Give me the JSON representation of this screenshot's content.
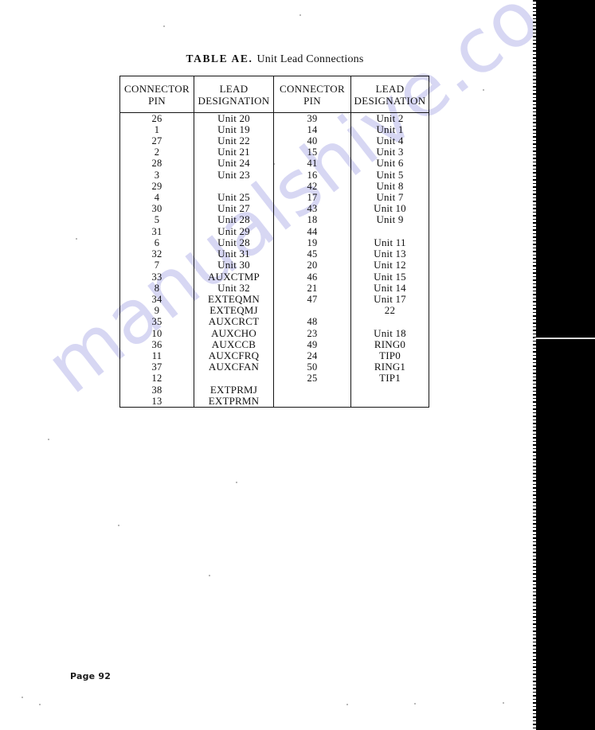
{
  "document": {
    "page_number_label": "Page 92",
    "watermark_text": "manualshive.com"
  },
  "caption": {
    "label": "TABLE AE.",
    "title": "Unit Lead Connections"
  },
  "table": {
    "headers": [
      {
        "line1": "CONNECTOR",
        "line2": "PIN"
      },
      {
        "line1": "LEAD",
        "line2": "DESIGNATION"
      },
      {
        "line1": "CONNECTOR",
        "line2": "PIN"
      },
      {
        "line1": "LEAD",
        "line2": "DESIGNATION"
      }
    ],
    "rows": [
      {
        "pin_a": "26",
        "lead_a": "Unit 20",
        "pin_b": "39",
        "lead_b": "Unit 2"
      },
      {
        "pin_a": "1",
        "lead_a": "Unit 19",
        "pin_b": "14",
        "lead_b": "Unit 1"
      },
      {
        "pin_a": "27",
        "lead_a": "Unit 22",
        "pin_b": "40",
        "lead_b": "Unit 4"
      },
      {
        "pin_a": "2",
        "lead_a": "Unit 21",
        "pin_b": "15",
        "lead_b": "Unit 3"
      },
      {
        "pin_a": "28",
        "lead_a": "Unit 24",
        "pin_b": "41",
        "lead_b": "Unit 6"
      },
      {
        "pin_a": "3",
        "lead_a": "Unit 23",
        "pin_b": "16",
        "lead_b": "Unit 5"
      },
      {
        "pin_a": "29",
        "lead_a": "",
        "pin_b": "42",
        "lead_b": "Unit 8"
      },
      {
        "pin_a": "4",
        "lead_a": "Unit 25",
        "pin_b": "17",
        "lead_b": "Unit 7"
      },
      {
        "pin_a": "30",
        "lead_a": "Unit 27",
        "pin_b": "43",
        "lead_b": "Unit 10"
      },
      {
        "pin_a": "5",
        "lead_a": "Unit 28",
        "pin_b": "18",
        "lead_b": "Unit 9"
      },
      {
        "pin_a": "31",
        "lead_a": "Unit 29",
        "pin_b": "44",
        "lead_b": ""
      },
      {
        "pin_a": "6",
        "lead_a": "Unit 28",
        "pin_b": "19",
        "lead_b": "Unit 11"
      },
      {
        "pin_a": "32",
        "lead_a": "Unit 31",
        "pin_b": "45",
        "lead_b": "Unit 13"
      },
      {
        "pin_a": "7",
        "lead_a": "Unit 30",
        "pin_b": "20",
        "lead_b": "Unit 12"
      },
      {
        "pin_a": "33",
        "lead_a": "AUXCTMP",
        "pin_b": "46",
        "lead_b": "Unit 15"
      },
      {
        "pin_a": "8",
        "lead_a": "Unit 32",
        "pin_b": "21",
        "lead_b": "Unit 14"
      },
      {
        "pin_a": "34",
        "lead_a": "EXTEQMN",
        "pin_b": "47",
        "lead_b": "Unit 17"
      },
      {
        "pin_a": "9",
        "lead_a": "EXTEQMJ",
        "pin_b": "",
        "lead_b": "22"
      },
      {
        "pin_a": "35",
        "lead_a": "AUXCRCT",
        "pin_b": "48",
        "lead_b": ""
      },
      {
        "pin_a": "10",
        "lead_a": "AUXCHO",
        "pin_b": "23",
        "lead_b": "Unit 18"
      },
      {
        "pin_a": "36",
        "lead_a": "AUXCCB",
        "pin_b": "49",
        "lead_b": "RING0"
      },
      {
        "pin_a": "11",
        "lead_a": "AUXCFRQ",
        "pin_b": "24",
        "lead_b": "TIP0"
      },
      {
        "pin_a": "37",
        "lead_a": "AUXCFAN",
        "pin_b": "50",
        "lead_b": "RING1"
      },
      {
        "pin_a": "12",
        "lead_a": "",
        "pin_b": "25",
        "lead_b": "TIP1"
      },
      {
        "pin_a": "38",
        "lead_a": "EXTPRMJ",
        "pin_b": "",
        "lead_b": ""
      },
      {
        "pin_a": "13",
        "lead_a": "EXTPRMN",
        "pin_b": "",
        "lead_b": ""
      }
    ]
  }
}
